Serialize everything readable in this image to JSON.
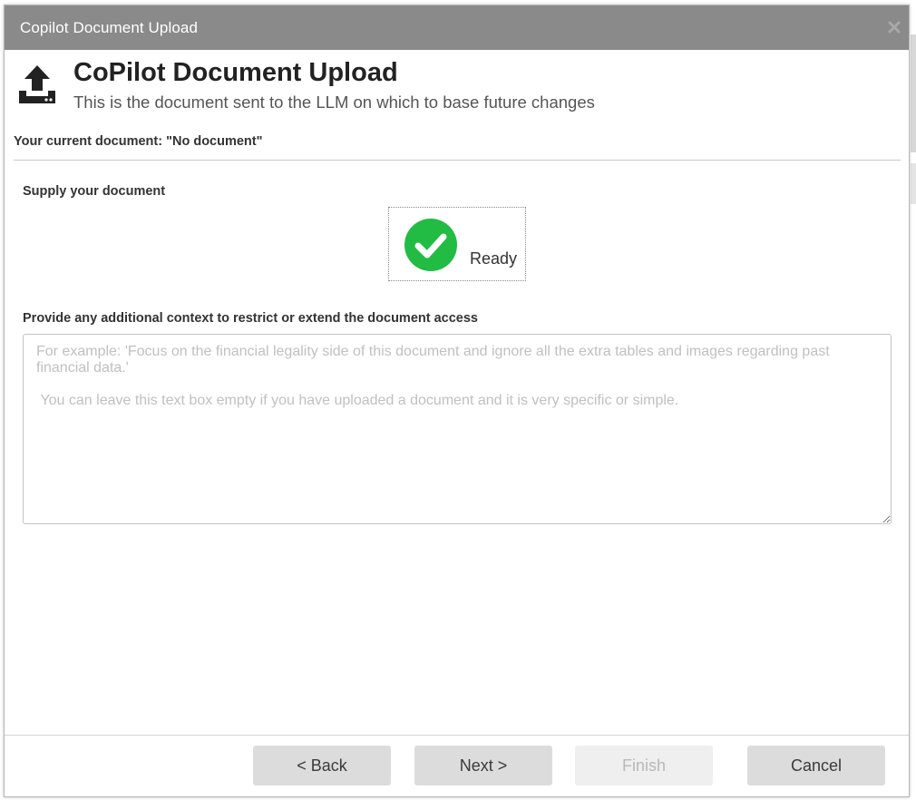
{
  "window": {
    "title": "Copilot Document Upload",
    "close_icon": "close-icon"
  },
  "header": {
    "icon": "upload-icon",
    "title": "CoPilot Document Upload",
    "subtitle": "This is the document sent to the LLM on which to base future changes"
  },
  "current_document": {
    "label": "Your current document: \"No document\""
  },
  "supply": {
    "label": "Supply your document",
    "status_icon": "check-circle-icon",
    "status_color": "#22bb44",
    "status_text": "Ready"
  },
  "context": {
    "label": "Provide any additional context to restrict or extend the document access",
    "value": "",
    "placeholder": "For example: 'Focus on the financial legality side of this document and ignore all the extra tables and images regarding past financial data.'\n\n You can leave this text box empty if you have uploaded a document and it is very specific or simple."
  },
  "footer": {
    "back_label": "< Back",
    "next_label": "Next >",
    "finish_label": "Finish",
    "cancel_label": "Cancel"
  },
  "colors": {
    "titlebar": "#8a8a8a",
    "button": "#dcdcdc",
    "button_disabled": "#efefef"
  }
}
